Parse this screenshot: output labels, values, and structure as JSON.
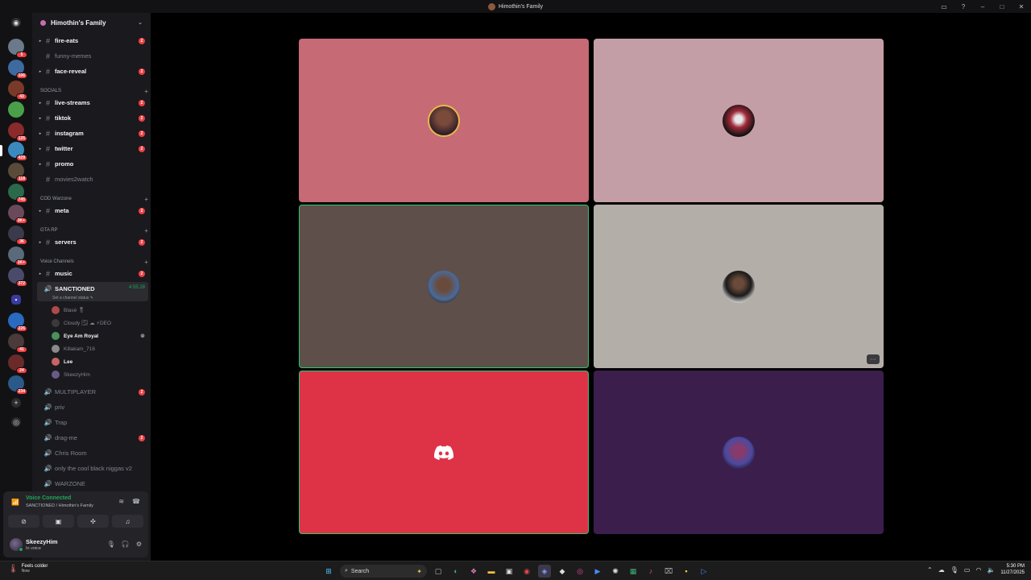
{
  "window": {
    "title": "Himothin's Family"
  },
  "server": {
    "name": "Himothin's Family"
  },
  "rail_badges": [
    "21",
    "5",
    "106",
    "43",
    "125",
    "429",
    "118",
    "745",
    "3K+",
    "36",
    "1K+",
    "372",
    "226",
    "41",
    "24",
    "234"
  ],
  "channels_top": [
    {
      "name": "fire-eats",
      "badge": "2",
      "state": "unread"
    },
    {
      "name": "funny-memes",
      "badge": "",
      "state": "muted"
    },
    {
      "name": "face-reveal",
      "badge": "2",
      "state": "unread"
    }
  ],
  "categories": {
    "socials": "SOCIALS",
    "cod": "COD Warzone",
    "gta": "GTA RP",
    "voice": "Voice Channels"
  },
  "channels_socials": [
    {
      "name": "live-streams",
      "badge": "2"
    },
    {
      "name": "tiktok",
      "badge": "2"
    },
    {
      "name": "instagram",
      "badge": "2"
    },
    {
      "name": "twitter",
      "badge": "2"
    },
    {
      "name": "promo",
      "badge": ""
    },
    {
      "name": "movies2watch",
      "badge": ""
    }
  ],
  "channels_cod": [
    {
      "name": "meta",
      "badge": "2"
    }
  ],
  "channels_gta": [
    {
      "name": "servers",
      "badge": "2"
    }
  ],
  "voice_channels": {
    "music": {
      "name": "music",
      "badge": "2"
    },
    "active": {
      "name": "SANCTIONED",
      "timer": "4:55:28",
      "status_placeholder": "Set a channel status"
    },
    "users": [
      {
        "name": "Blasé 🎖",
        "color": "#b04a4a",
        "muted": true
      },
      {
        "name": "Cloudy 🌫 ☁ ⚡DEO",
        "color": "#3a3a3a",
        "muted": true
      },
      {
        "name": "Eye Am Royal",
        "color": "#5a8a5a",
        "muted": false
      },
      {
        "name": "Killakam_716",
        "color": "#8a8a8a",
        "muted": true
      },
      {
        "name": "Lee",
        "color": "#c86464",
        "muted": false
      },
      {
        "name": "SkeezyHim",
        "color": "#6a5a8a",
        "muted": true
      }
    ],
    "others": [
      {
        "name": "MULTIPLAYER",
        "badge": "2"
      },
      {
        "name": "priv",
        "badge": ""
      },
      {
        "name": "Trap",
        "badge": ""
      },
      {
        "name": "drag-me",
        "badge": "2"
      },
      {
        "name": "Chris Room",
        "badge": ""
      },
      {
        "name": "only the cool black niggas v2",
        "badge": ""
      },
      {
        "name": "WARZONE",
        "badge": ""
      }
    ]
  },
  "voice_panel": {
    "status": "Voice Connected",
    "channel": "SANCTIONED / Himothin's Family"
  },
  "user_panel": {
    "name": "SkeezyHim",
    "status": "In voice"
  },
  "tiles": [
    {
      "bg": "#c66a76",
      "avatar": "woman-avatar"
    },
    {
      "bg": "#c49ea6",
      "avatar": "joker-avatar"
    },
    {
      "bg": "#5e4f4a",
      "avatar": "man-avatar",
      "speaking": true
    },
    {
      "bg": "#b4aea8",
      "avatar": "man-suit-avatar"
    },
    {
      "bg": "#de3347",
      "avatar": "discord-logo",
      "speaking": true
    },
    {
      "bg": "#3b1e4c",
      "avatar": "purple-avatar"
    }
  ],
  "taskbar": {
    "weather_title": "Feels colder",
    "weather_sub": "Now",
    "search_label": "Search",
    "time": "5:30 PM",
    "date": "11/27/2025"
  }
}
